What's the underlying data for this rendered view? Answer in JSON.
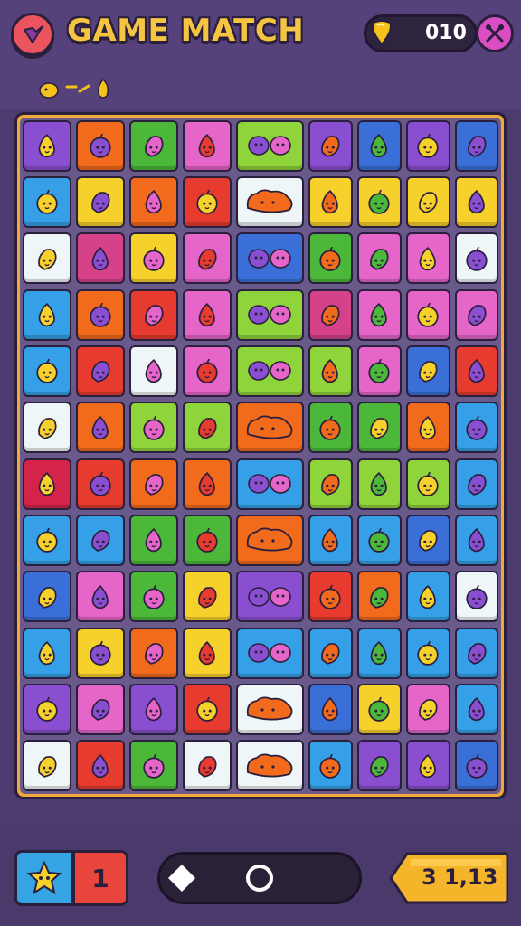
{
  "header": {
    "title": "GAME MATCH",
    "coins": "010",
    "menu_icon": "heart-check-icon",
    "coin_icon": "gem-icon",
    "tools_icon": "crossed-tools-icon"
  },
  "indicator_icons": [
    "fruit-icon",
    "dash-icon",
    "fruit-icon"
  ],
  "palette": {
    "purple": "#8a4fd1",
    "orange": "#f26b1d",
    "green": "#4cb83a",
    "lime": "#8ed43a",
    "pink": "#e665c9",
    "magenta": "#d6428a",
    "blue": "#35a0e8",
    "darkblue": "#3a6fd8",
    "yellow": "#f7d12b",
    "red": "#e63b2e",
    "white": "#eef6f8",
    "crimson": "#d5244a"
  },
  "board": {
    "columns": 9,
    "rows": 12,
    "tiles": [
      [
        "purple",
        "orange",
        "green",
        "pink",
        "lime2",
        "purple",
        "darkblue",
        "purple",
        "darkblue"
      ],
      [
        "blue",
        "yellow",
        "orange",
        "red",
        "white2",
        "yellow",
        "yellow",
        "yellow",
        "yellow"
      ],
      [
        "white",
        "magenta",
        "yellow",
        "pink",
        "darkblue2",
        "green",
        "pink",
        "pink",
        "white"
      ],
      [
        "blue",
        "orange",
        "red",
        "pink",
        "lime2",
        "magenta",
        "pink",
        "pink",
        "pink"
      ],
      [
        "blue",
        "red",
        "white",
        "pink",
        "lime2",
        "lime",
        "pink",
        "darkblue",
        "red"
      ],
      [
        "white",
        "orange",
        "lime",
        "lime",
        "orange2",
        "green",
        "green",
        "orange",
        "blue"
      ],
      [
        "crimson",
        "red",
        "orange",
        "orange",
        "blue2",
        "lime3",
        "lime3",
        "lime",
        "blue"
      ],
      [
        "blue",
        "blue",
        "green",
        "green",
        "orange2",
        "blue",
        "blue",
        "darkblue",
        "blue"
      ],
      [
        "darkblue",
        "pink",
        "green",
        "yellow",
        "purple2",
        "red",
        "orange",
        "blue",
        "white"
      ],
      [
        "blue",
        "yellow",
        "orange",
        "yellow",
        "blue2",
        "blue",
        "blue",
        "blue",
        "blue"
      ],
      [
        "purple",
        "pink",
        "purple",
        "red",
        "white2",
        "darkblue",
        "yellow",
        "pink",
        "blue"
      ],
      [
        "white",
        "red",
        "green",
        "white",
        "white2",
        "blue",
        "purple",
        "purple",
        "darkblue"
      ]
    ]
  },
  "footer": {
    "booster_icon": "puzzle-star-icon",
    "booster_count": "1",
    "left_control_icon": "diamond-icon",
    "right_control_icon": "circle-icon",
    "score": "3 1,13"
  }
}
